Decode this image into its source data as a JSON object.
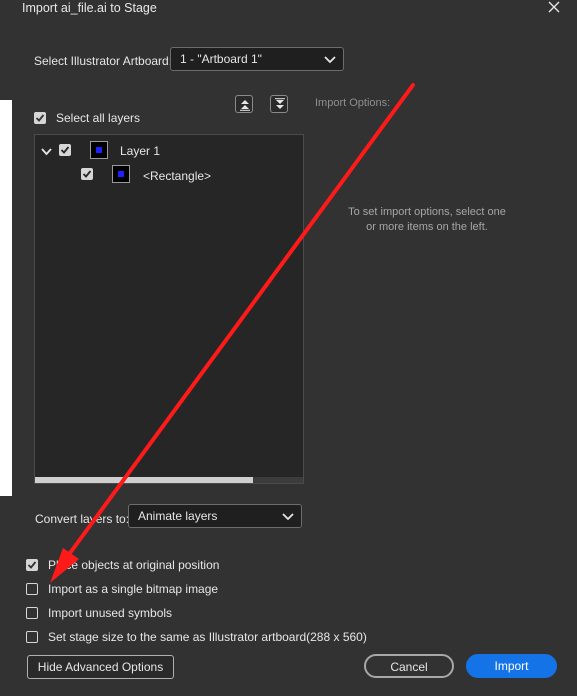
{
  "window": {
    "title": "Import ai_file.ai to Stage"
  },
  "artboard": {
    "label": "Select Illustrator Artboard:",
    "selected": "1 - \"Artboard 1\""
  },
  "layers": {
    "select_all_label": "Select all layers",
    "select_all_checked": true,
    "items": [
      {
        "name": "Layer 1",
        "checked": true,
        "expanded": true
      },
      {
        "name": "<Rectangle>",
        "checked": true
      }
    ]
  },
  "import_options": {
    "label": "Import Options:",
    "hint": "To set import options, select one or more items on the left."
  },
  "convert": {
    "label": "Convert layers to:",
    "selected": "Animate layers"
  },
  "options": [
    {
      "label": "Place objects at original position",
      "checked": true
    },
    {
      "label": "Import as a single bitmap image",
      "checked": false
    },
    {
      "label": "Import unused symbols",
      "checked": false
    },
    {
      "label": "Set stage size to the same as Illustrator artboard(288 x 560)",
      "checked": false
    }
  ],
  "buttons": {
    "advanced": "Hide Advanced Options",
    "cancel": "Cancel",
    "import": "Import"
  },
  "colors": {
    "background": "#323232",
    "panel": "#262626",
    "accent": "#1473e6",
    "annotation_arrow": "#ff1a1a"
  },
  "icons": {
    "close": "close-icon",
    "dropdown": "chevron-down-icon",
    "collapse_all": "collapse-all-icon",
    "expand_all": "expand-all-icon",
    "tree_toggle": "chevron-down-icon"
  }
}
